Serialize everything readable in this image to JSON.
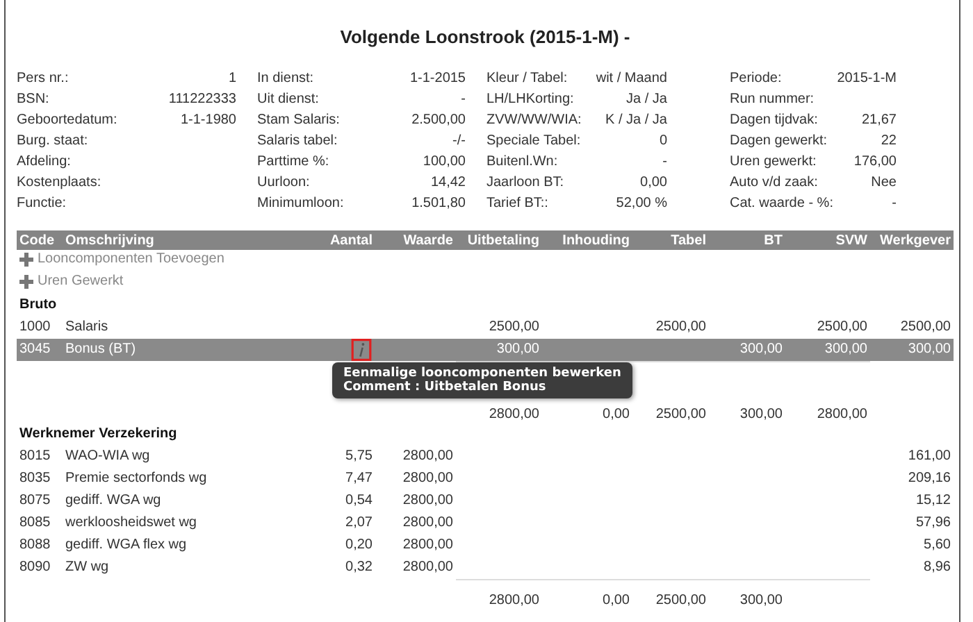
{
  "title": "Volgende Loonstrook (2015-1-M) -",
  "info_columns": [
    [
      {
        "label": "Pers nr.:",
        "value": "1"
      },
      {
        "label": "BSN:",
        "value": "111222333"
      },
      {
        "label": "Geboortedatum:",
        "value": "1-1-1980"
      },
      {
        "label": "Burg. staat:"
      },
      {
        "label": "Afdeling:"
      },
      {
        "label": "Kostenplaats:"
      },
      {
        "label": "Functie:"
      }
    ],
    [
      {
        "label": "In dienst:",
        "value": "1-1-2015"
      },
      {
        "label": "Uit dienst:",
        "value": "-"
      },
      {
        "label": "Stam Salaris:",
        "value": "2.500,00"
      },
      {
        "label": "Salaris tabel:",
        "value": "-/-"
      },
      {
        "label": "Parttime %:",
        "value": "100,00"
      },
      {
        "label": "Uurloon:",
        "value": "14,42"
      },
      {
        "label": "Minimumloon:",
        "value": "1.501,80"
      }
    ],
    [
      {
        "label": "Kleur / Tabel:",
        "value": "wit / Maand"
      },
      {
        "label": "LH/LHKorting:",
        "value": "Ja / Ja"
      },
      {
        "label": "ZVW/WW/WIA:",
        "value": "K / Ja / Ja"
      },
      {
        "label": "Speciale Tabel:",
        "value": "0"
      },
      {
        "label": "Buitenl.Wn:",
        "value": "-"
      },
      {
        "label": "Jaarloon BT:",
        "value": "0,00"
      },
      {
        "label": "Tarief BT::",
        "value": "52,00 %"
      }
    ],
    [
      {
        "label": "Periode:",
        "value": "2015-1-M"
      },
      {
        "label": "Run nummer:"
      },
      {
        "label": "Dagen tijdvak:",
        "value": "21,67"
      },
      {
        "label": "Dagen gewerkt:",
        "value": "22"
      },
      {
        "label": "Uren gewerkt:",
        "value": "176,00"
      },
      {
        "label": "Auto v/d zaak:",
        "value": "Nee"
      },
      {
        "label": "Cat. waarde - %:",
        "value": "-"
      }
    ]
  ],
  "columns": [
    "Code",
    "Omschrijving",
    "Aantal",
    "Waarde",
    "Uitbetaling",
    "Inhouding",
    "Tabel",
    "BT",
    "SVW",
    "Werkgever"
  ],
  "actions": [
    "Looncomponenten Toevoegen",
    "Uren Gewerkt"
  ],
  "groups": [
    {
      "title": "Bruto",
      "rows": [
        {
          "code": "1000",
          "description": "Salaris",
          "uitbetaling": "2500,00",
          "tabel": "2500,00",
          "svw": "2500,00",
          "werkgever": "2500,00",
          "selected": false
        },
        {
          "code": "3045",
          "description": "Bonus (BT)",
          "uitbetaling": "300,00",
          "bt": "300,00",
          "svw": "300,00",
          "werkgever": "300,00",
          "selected": true,
          "info": true,
          "tooltip": [
            "Eenmalige looncomponenten bewerken",
            "Comment : Uitbetalen Bonus"
          ]
        }
      ],
      "subtotal": {
        "uitbetaling": "2800,00",
        "inhouding": "0,00",
        "tabel": "2500,00",
        "bt": "300,00",
        "svw": "2800,00"
      }
    },
    {
      "title": "Werknemer Verzekering",
      "rows": [
        {
          "code": "8015",
          "description": "WAO-WIA wg",
          "aantal": "5,75",
          "waarde": "2800,00",
          "werkgever": "161,00",
          "selected": false
        },
        {
          "code": "8035",
          "description": "Premie sectorfonds wg",
          "aantal": "7,47",
          "waarde": "2800,00",
          "werkgever": "209,16",
          "selected": false
        },
        {
          "code": "8075",
          "description": "gediff. WGA wg",
          "aantal": "0,54",
          "waarde": "2800,00",
          "werkgever": "15,12",
          "selected": false
        },
        {
          "code": "8085",
          "description": "werkloosheidswet wg",
          "aantal": "2,07",
          "waarde": "2800,00",
          "werkgever": "57,96",
          "selected": false
        },
        {
          "code": "8088",
          "description": "gediff. WGA flex wg",
          "aantal": "0,20",
          "waarde": "2800,00",
          "werkgever": "5,60",
          "selected": false
        },
        {
          "code": "8090",
          "description": "ZW wg",
          "aantal": "0,32",
          "waarde": "2800,00",
          "werkgever": "8,96",
          "selected": false
        }
      ],
      "subtotal": {
        "uitbetaling": "2800,00",
        "inhouding": "0,00",
        "tabel": "2500,00",
        "bt": "300,00"
      }
    }
  ]
}
